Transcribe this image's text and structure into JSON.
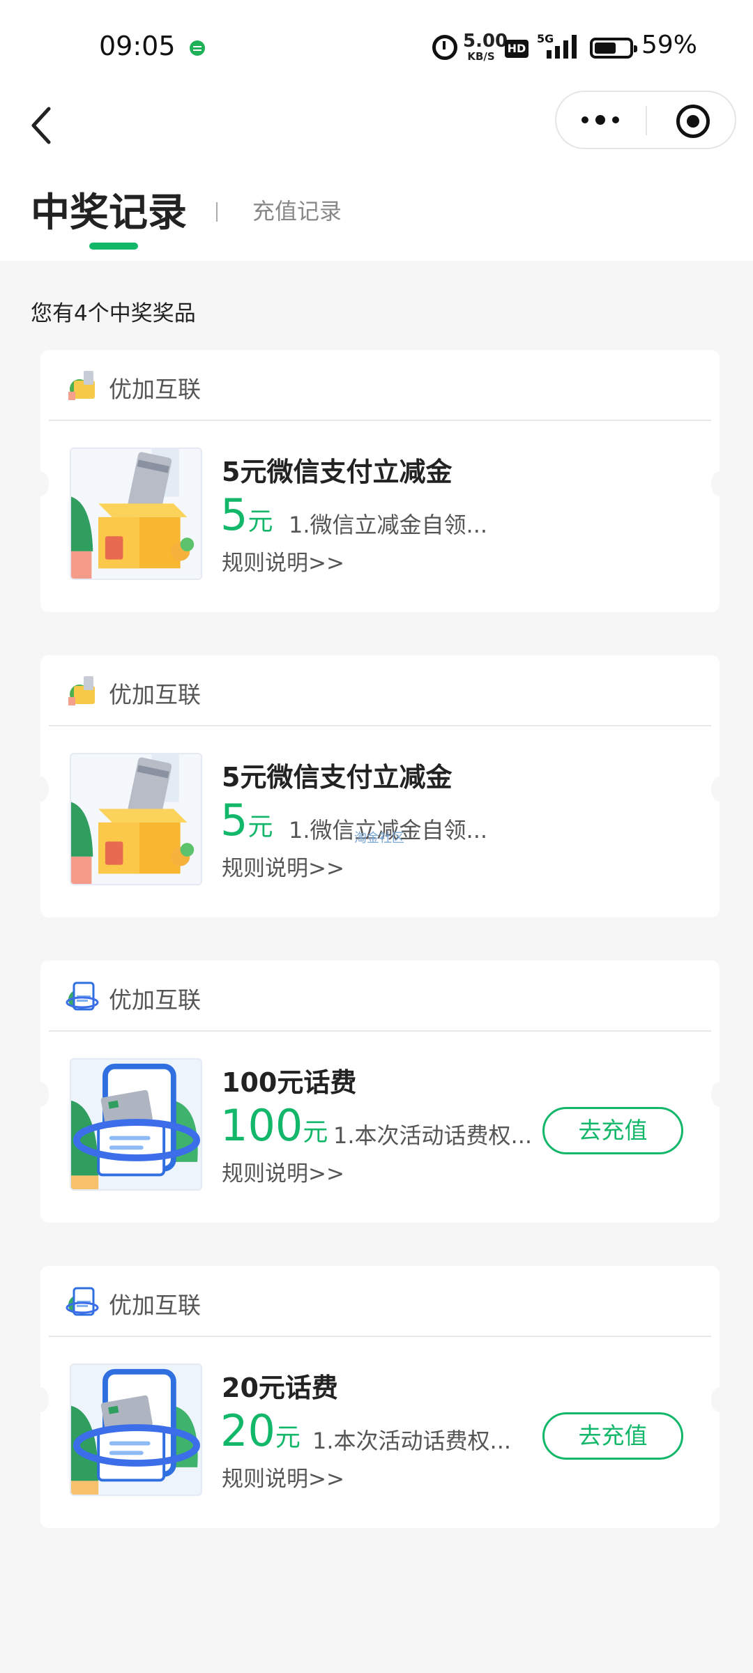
{
  "status_bar": {
    "time": "09:05",
    "speed_value": "5.00",
    "speed_unit": "KB/S",
    "hd": "HD",
    "network": "5G",
    "battery": "59%",
    "battery_level": 0.59
  },
  "tabs": {
    "active": "中奖记录",
    "inactive": "充值记录",
    "accent": "#12b76a"
  },
  "summary": "您有4个中奖奖品",
  "watermark": "淘金社区",
  "cards": [
    {
      "merchant": "优加互联",
      "icon": "gift-box-card-icon",
      "title": "5元微信支付立减金",
      "amount": "5",
      "unit": "元",
      "desc": "1.微信立减金自领...",
      "rules": "规则说明>>"
    },
    {
      "merchant": "优加互联",
      "icon": "gift-box-card-icon",
      "title": "5元微信支付立减金",
      "amount": "5",
      "unit": "元",
      "desc": "1.微信立减金自领...",
      "rules": "规则说明>>"
    },
    {
      "merchant": "优加互联",
      "icon": "phone-bill-icon",
      "title": "100元话费",
      "amount": "100",
      "unit": "元",
      "desc": "1.本次活动话费权...",
      "rules": "规则说明>>",
      "button": "去充值"
    },
    {
      "merchant": "优加互联",
      "icon": "phone-bill-icon",
      "title": "20元话费",
      "amount": "20",
      "unit": "元",
      "desc": "1.本次活动话费权...",
      "rules": "规则说明>>",
      "button": "去充值"
    }
  ]
}
